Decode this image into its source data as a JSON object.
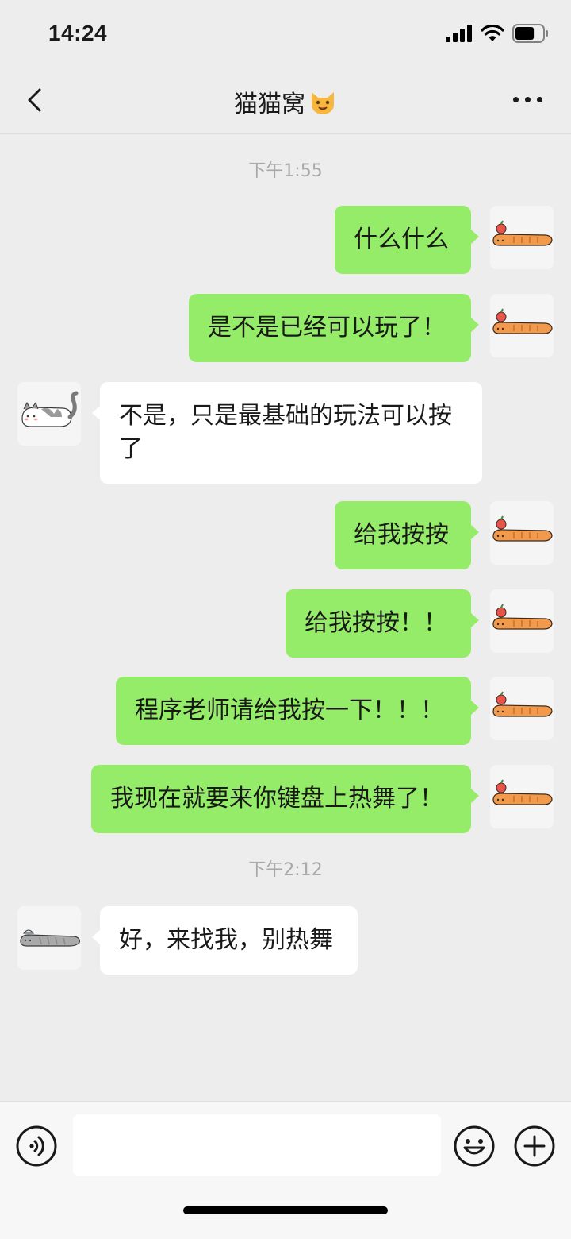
{
  "status_bar": {
    "time": "14:24",
    "battery_level": 0.7
  },
  "header": {
    "title": "猫猫窝",
    "title_emoji": "cat-face-icon"
  },
  "messages": [
    {
      "type": "time",
      "text": "下午1:55"
    },
    {
      "type": "msg",
      "from": "me",
      "text": "什么什么"
    },
    {
      "type": "msg",
      "from": "me",
      "text": "是不是已经可以玩了！"
    },
    {
      "type": "msg",
      "from": "them",
      "text": "不是，只是最基础的玩法可以按了"
    },
    {
      "type": "msg",
      "from": "me",
      "text": "给我按按"
    },
    {
      "type": "msg",
      "from": "me",
      "text": "给我按按！！"
    },
    {
      "type": "msg",
      "from": "me",
      "text": "程序老师请给我按一下！！！"
    },
    {
      "type": "msg",
      "from": "me",
      "text": "我现在就要来你键盘上热舞了！"
    },
    {
      "type": "time",
      "text": "下午2:12"
    },
    {
      "type": "msg",
      "from": "them",
      "text": "好，来找我，别热舞"
    }
  ],
  "colors": {
    "my_bubble": "#95EC69",
    "their_bubble": "#FFFFFF",
    "background": "#EDEDED"
  },
  "input_bar": {
    "voice_icon": "voice-icon",
    "emoji_icon": "emoji-icon",
    "plus_icon": "plus-icon",
    "text_value": ""
  }
}
